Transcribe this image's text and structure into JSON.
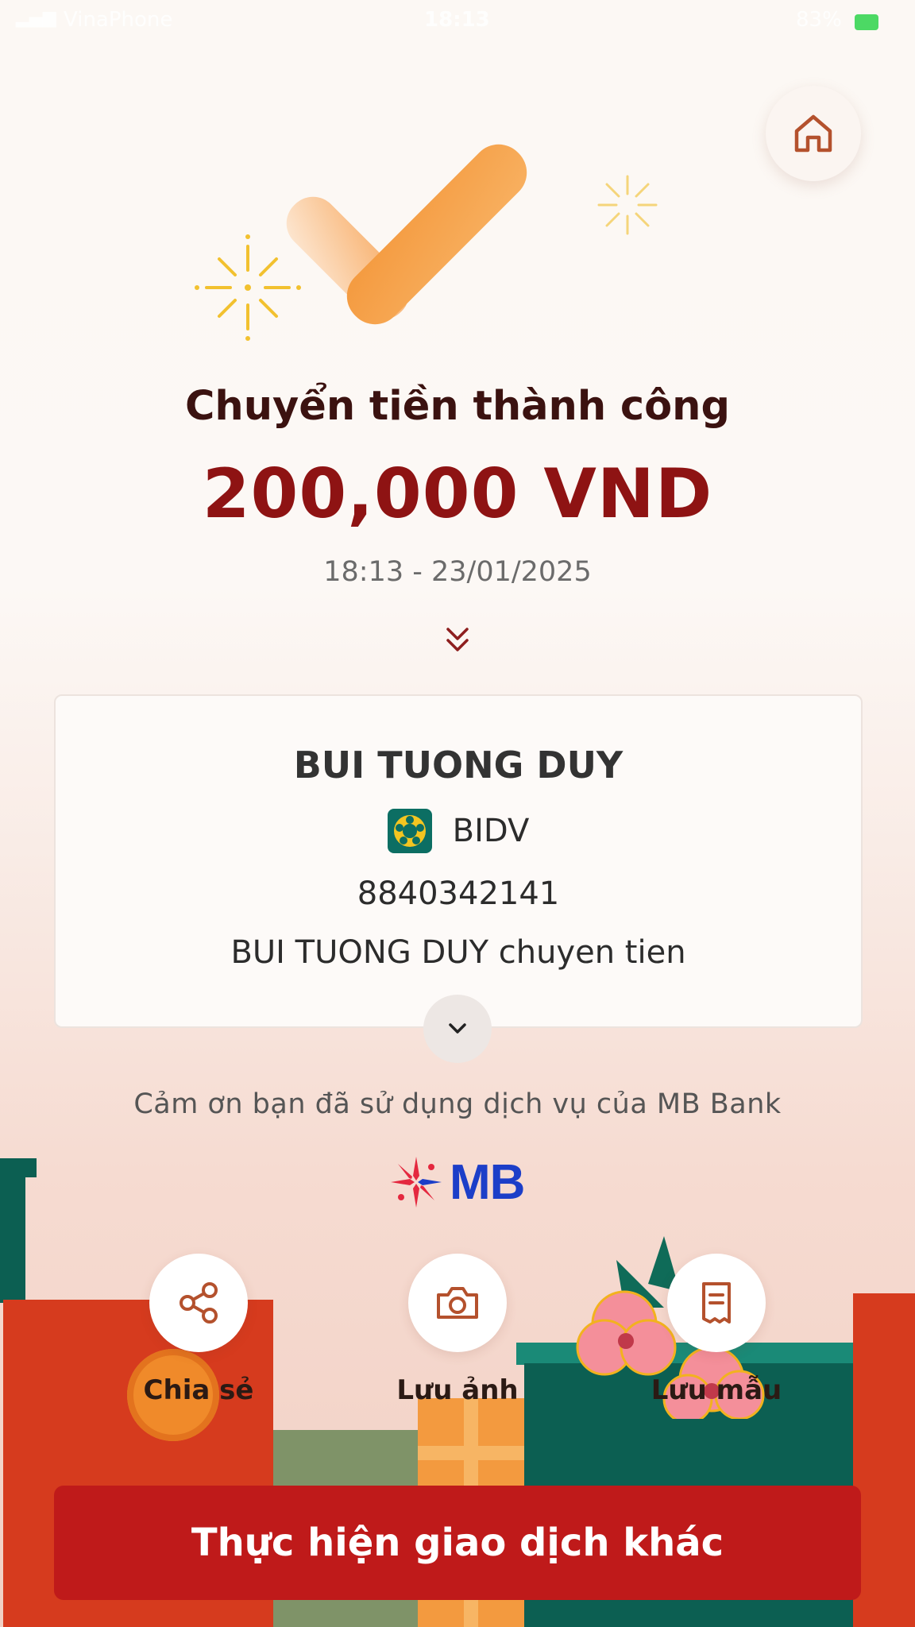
{
  "status_bar": {
    "carrier": "VinaPhone",
    "time": "18:13",
    "battery": "83%"
  },
  "header": {
    "home_icon": "home-icon"
  },
  "result": {
    "title": "Chuyển tiền thành công",
    "amount": "200,000 VND",
    "timestamp": "18:13 - 23/01/2025"
  },
  "recipient": {
    "name": "BUI TUONG DUY",
    "bank": "BIDV",
    "account": "8840342141",
    "message": "BUI TUONG DUY chuyen tien"
  },
  "footer": {
    "thanks": "Cảm ơn bạn đã sử dụng dịch vụ của MB Bank",
    "logo_text": "MB"
  },
  "actions": [
    {
      "label": "Chia sẻ",
      "icon": "share-icon"
    },
    {
      "label": "Lưu ảnh",
      "icon": "camera-icon"
    },
    {
      "label": "Lưu mẫu",
      "icon": "receipt-icon"
    }
  ],
  "cta": {
    "label": "Thực hiện giao dịch khác"
  },
  "colors": {
    "primary_red": "#bf1a1a",
    "amount_red": "#8e1313",
    "check_orange": "#f59a3a",
    "brand_blue": "#1c3ec8"
  }
}
